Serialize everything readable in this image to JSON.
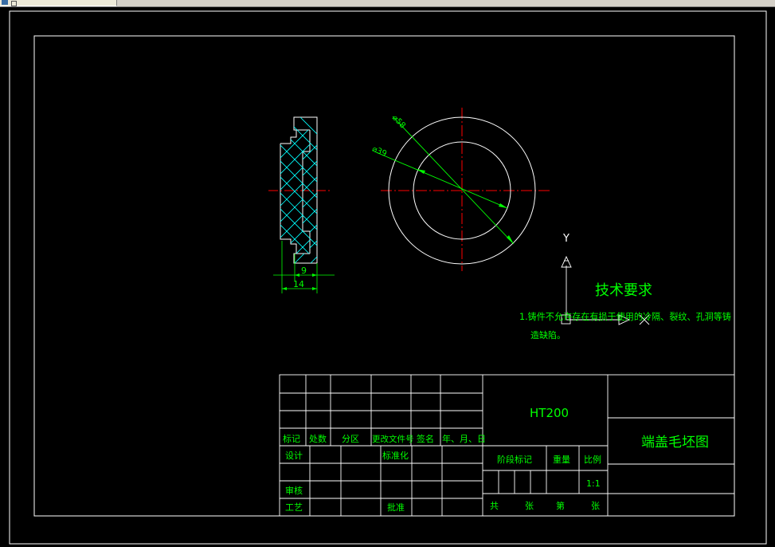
{
  "drawing": {
    "dimensions": {
      "outer_diameter": "⌀58",
      "inner_diameter": "⌀39",
      "width_small": "9",
      "width_total": "14"
    },
    "axis_label": "Y",
    "technical_requirements": {
      "title": "技术要求",
      "line1": "1.铸件不允许存在有损于使用的冷隔、裂纹、孔洞等铸",
      "line2": "造缺陷。"
    }
  },
  "title_block": {
    "material": "HT200",
    "drawing_name": "端盖毛坯图",
    "revision_headers": [
      "标记",
      "处数",
      "分区",
      "更改文件号",
      "签名",
      "年、月、日"
    ],
    "design": "设计",
    "standardization": "标准化",
    "stage_mark": "阶段标记",
    "weight": "重量",
    "scale_label": "比例",
    "scale_value": "1:1",
    "review": "审核",
    "process": "工艺",
    "approve": "批准",
    "total": "共",
    "sheets1": "张",
    "sheet_no": "第",
    "sheets2": "张"
  },
  "colors": {
    "line": "#ffffff",
    "text": "#00ff00",
    "centerline": "#ff0000",
    "hatch": "#00ffff",
    "dimension": "#00ff00"
  }
}
